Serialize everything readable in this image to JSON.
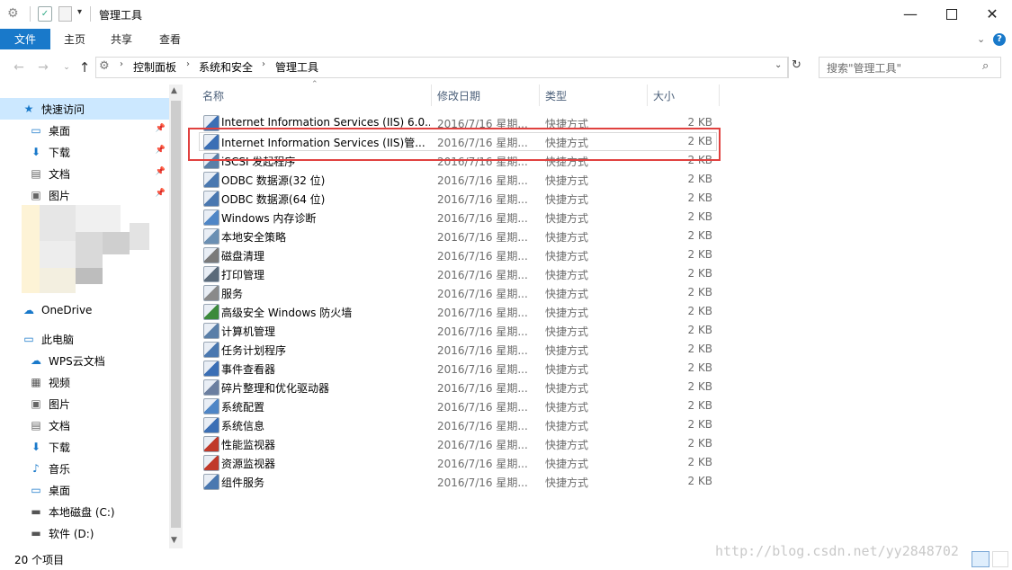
{
  "window": {
    "title": "管理工具",
    "controls": [
      "minimize-icon",
      "maximize-icon",
      "close-icon"
    ]
  },
  "ribbon": {
    "tabs": [
      "文件",
      "主页",
      "共享",
      "查看"
    ]
  },
  "address": {
    "crumbs": [
      "控制面板",
      "系统和安全",
      "管理工具"
    ],
    "search_placeholder": "搜索\"管理工具\""
  },
  "nav": {
    "items": [
      {
        "label": "快速访问",
        "icon": "star-icon",
        "selected": true,
        "pinned": false
      },
      {
        "label": "桌面",
        "icon": "desktop-icon",
        "selected": false,
        "pinned": true
      },
      {
        "label": "下载",
        "icon": "download-icon",
        "selected": false,
        "pinned": true
      },
      {
        "label": "文档",
        "icon": "document-icon",
        "selected": false,
        "pinned": true
      },
      {
        "label": "图片",
        "icon": "picture-icon",
        "selected": false,
        "pinned": true
      },
      {
        "label": "OneDrive",
        "icon": "cloud-icon",
        "selected": false,
        "pinned": false
      },
      {
        "label": "此电脑",
        "icon": "computer-icon",
        "selected": false,
        "pinned": false
      },
      {
        "label": "WPS云文档",
        "icon": "cloud-outline-icon",
        "selected": false,
        "pinned": false
      },
      {
        "label": "视频",
        "icon": "video-icon",
        "selected": false,
        "pinned": false
      },
      {
        "label": "图片",
        "icon": "picture-icon",
        "selected": false,
        "pinned": false
      },
      {
        "label": "文档",
        "icon": "document-icon",
        "selected": false,
        "pinned": false
      },
      {
        "label": "下载",
        "icon": "download-icon",
        "selected": false,
        "pinned": false
      },
      {
        "label": "音乐",
        "icon": "music-icon",
        "selected": false,
        "pinned": false
      },
      {
        "label": "桌面",
        "icon": "desktop-icon",
        "selected": false,
        "pinned": false
      },
      {
        "label": "本地磁盘 (C:)",
        "icon": "drive-icon",
        "selected": false,
        "pinned": false
      },
      {
        "label": "软件 (D:)",
        "icon": "drive-icon",
        "selected": false,
        "pinned": false
      }
    ]
  },
  "columns": [
    "名称",
    "修改日期",
    "类型",
    "大小"
  ],
  "files": [
    {
      "name": "Internet Information Services (IIS) 6.0...",
      "date": "2016/7/16 星期...",
      "type": "快捷方式",
      "size": "2 KB",
      "color": "#3b6fb5"
    },
    {
      "name": "Internet Information Services (IIS)管...",
      "date": "2016/7/16 星期...",
      "type": "快捷方式",
      "size": "2 KB",
      "color": "#3b6fb5"
    },
    {
      "name": "iSCSI 发起程序",
      "date": "2016/7/16 星期...",
      "type": "快捷方式",
      "size": "2 KB",
      "color": "#5a7fa8"
    },
    {
      "name": "ODBC 数据源(32 位)",
      "date": "2016/7/16 星期...",
      "type": "快捷方式",
      "size": "2 KB",
      "color": "#4a78b0"
    },
    {
      "name": "ODBC 数据源(64 位)",
      "date": "2016/7/16 星期...",
      "type": "快捷方式",
      "size": "2 KB",
      "color": "#4a78b0"
    },
    {
      "name": "Windows 内存诊断",
      "date": "2016/7/16 星期...",
      "type": "快捷方式",
      "size": "2 KB",
      "color": "#4f86c6"
    },
    {
      "name": "本地安全策略",
      "date": "2016/7/16 星期...",
      "type": "快捷方式",
      "size": "2 KB",
      "color": "#6a8fb3"
    },
    {
      "name": "磁盘清理",
      "date": "2016/7/16 星期...",
      "type": "快捷方式",
      "size": "2 KB",
      "color": "#7a7a7a"
    },
    {
      "name": "打印管理",
      "date": "2016/7/16 星期...",
      "type": "快捷方式",
      "size": "2 KB",
      "color": "#5a6a7a"
    },
    {
      "name": "服务",
      "date": "2016/7/16 星期...",
      "type": "快捷方式",
      "size": "2 KB",
      "color": "#8a8a8a"
    },
    {
      "name": "高级安全 Windows 防火墙",
      "date": "2016/7/16 星期...",
      "type": "快捷方式",
      "size": "2 KB",
      "color": "#3c8a3c"
    },
    {
      "name": "计算机管理",
      "date": "2016/7/16 星期...",
      "type": "快捷方式",
      "size": "2 KB",
      "color": "#5a7fa8"
    },
    {
      "name": "任务计划程序",
      "date": "2016/7/16 星期...",
      "type": "快捷方式",
      "size": "2 KB",
      "color": "#4a78b0"
    },
    {
      "name": "事件查看器",
      "date": "2016/7/16 星期...",
      "type": "快捷方式",
      "size": "2 KB",
      "color": "#3b6fb5"
    },
    {
      "name": "碎片整理和优化驱动器",
      "date": "2016/7/16 星期...",
      "type": "快捷方式",
      "size": "2 KB",
      "color": "#6b7fa0"
    },
    {
      "name": "系统配置",
      "date": "2016/7/16 星期...",
      "type": "快捷方式",
      "size": "2 KB",
      "color": "#4f86c6"
    },
    {
      "name": "系统信息",
      "date": "2016/7/16 星期...",
      "type": "快捷方式",
      "size": "2 KB",
      "color": "#3b6fb5"
    },
    {
      "name": "性能监视器",
      "date": "2016/7/16 星期...",
      "type": "快捷方式",
      "size": "2 KB",
      "color": "#c0392b"
    },
    {
      "name": "资源监视器",
      "date": "2016/7/16 星期...",
      "type": "快捷方式",
      "size": "2 KB",
      "color": "#c0392b"
    },
    {
      "name": "组件服务",
      "date": "2016/7/16 星期...",
      "type": "快捷方式",
      "size": "2 KB",
      "color": "#4a78b0"
    }
  ],
  "status": {
    "item_count": "20 个项目"
  },
  "watermark": "http://blog.csdn.net/yy2848702"
}
